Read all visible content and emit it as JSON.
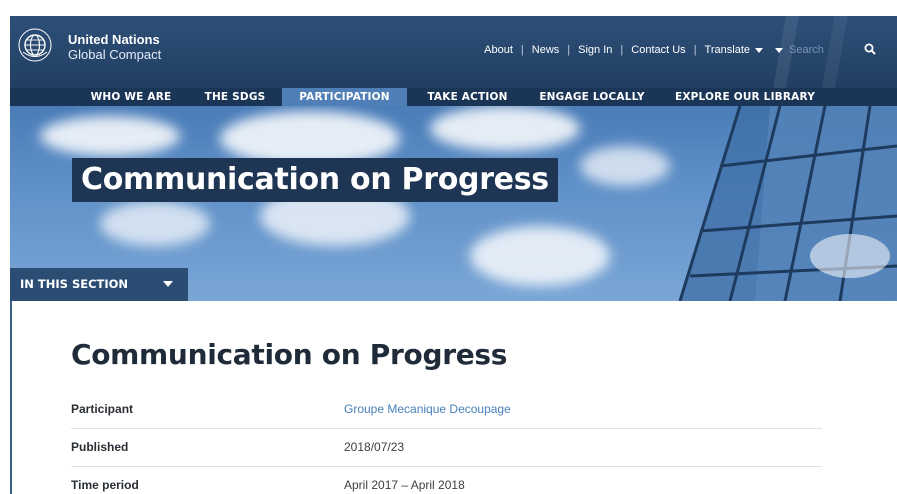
{
  "header": {
    "brand_line1": "United Nations",
    "brand_line2": "Global Compact",
    "logo_icon": "un-global-compact-logo",
    "utility_links": [
      "About",
      "News",
      "Sign In",
      "Contact Us"
    ],
    "translate_label": "Translate",
    "search_placeholder": "Search"
  },
  "nav": {
    "items": [
      {
        "label": "WHO WE ARE"
      },
      {
        "label": "THE SDGS"
      },
      {
        "label": "PARTICIPATION",
        "active": true
      },
      {
        "label": "TAKE ACTION"
      },
      {
        "label": "ENGAGE LOCALLY"
      },
      {
        "label": "EXPLORE OUR LIBRARY"
      }
    ]
  },
  "hero": {
    "title": "Communication on Progress",
    "section_toggle": "IN THIS SECTION"
  },
  "main": {
    "title": "Communication on Progress",
    "details": [
      {
        "label": "Participant",
        "value": "Groupe Mecanique Decoupage",
        "is_link": true
      },
      {
        "label": "Published",
        "value": "2018/07/23"
      },
      {
        "label": "Time period",
        "value": "April 2017  –  April 2018"
      }
    ]
  },
  "colors": {
    "header_bg": "#27466c",
    "nav_bg": "#1b3556",
    "nav_active": "#4f7fb6",
    "link": "#4a80b9",
    "title_text": "#1f2b38"
  }
}
